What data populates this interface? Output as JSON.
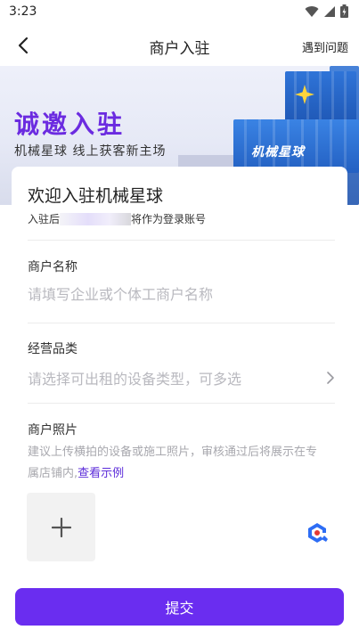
{
  "status_bar": {
    "time": "3:23",
    "icons": [
      "wifi-icon",
      "signal-icon",
      "battery-icon"
    ]
  },
  "header": {
    "title": "商户入驻",
    "help_link": "遇到问题",
    "back_icon": "chevron-left-icon"
  },
  "banner": {
    "slogan": "诚邀入驻",
    "subtitle": "机械星球 线上获客新主场",
    "brand_mark": "机械星球"
  },
  "form": {
    "welcome_title": "欢迎入驻机械星球",
    "welcome_prefix": "入驻后",
    "welcome_suffix": "将作为登录账号",
    "merchant_name": {
      "label": "商户名称",
      "placeholder": "请填写企业或个体工商户名称"
    },
    "category": {
      "label": "经营品类",
      "placeholder": "请选择可出租的设备类型，可多选"
    },
    "photo": {
      "label": "商户照片",
      "hint": "建议上传横拍的设备或施工照片，审核通过后将展示在专属店铺内,",
      "hint_link": "查看示例"
    }
  },
  "footer": {
    "submit_label": "提交"
  },
  "colors": {
    "accent": "#6a2df0",
    "link": "#5b2bd9",
    "slogan": "#6b2be0",
    "placeholder": "#b9b9bf"
  }
}
